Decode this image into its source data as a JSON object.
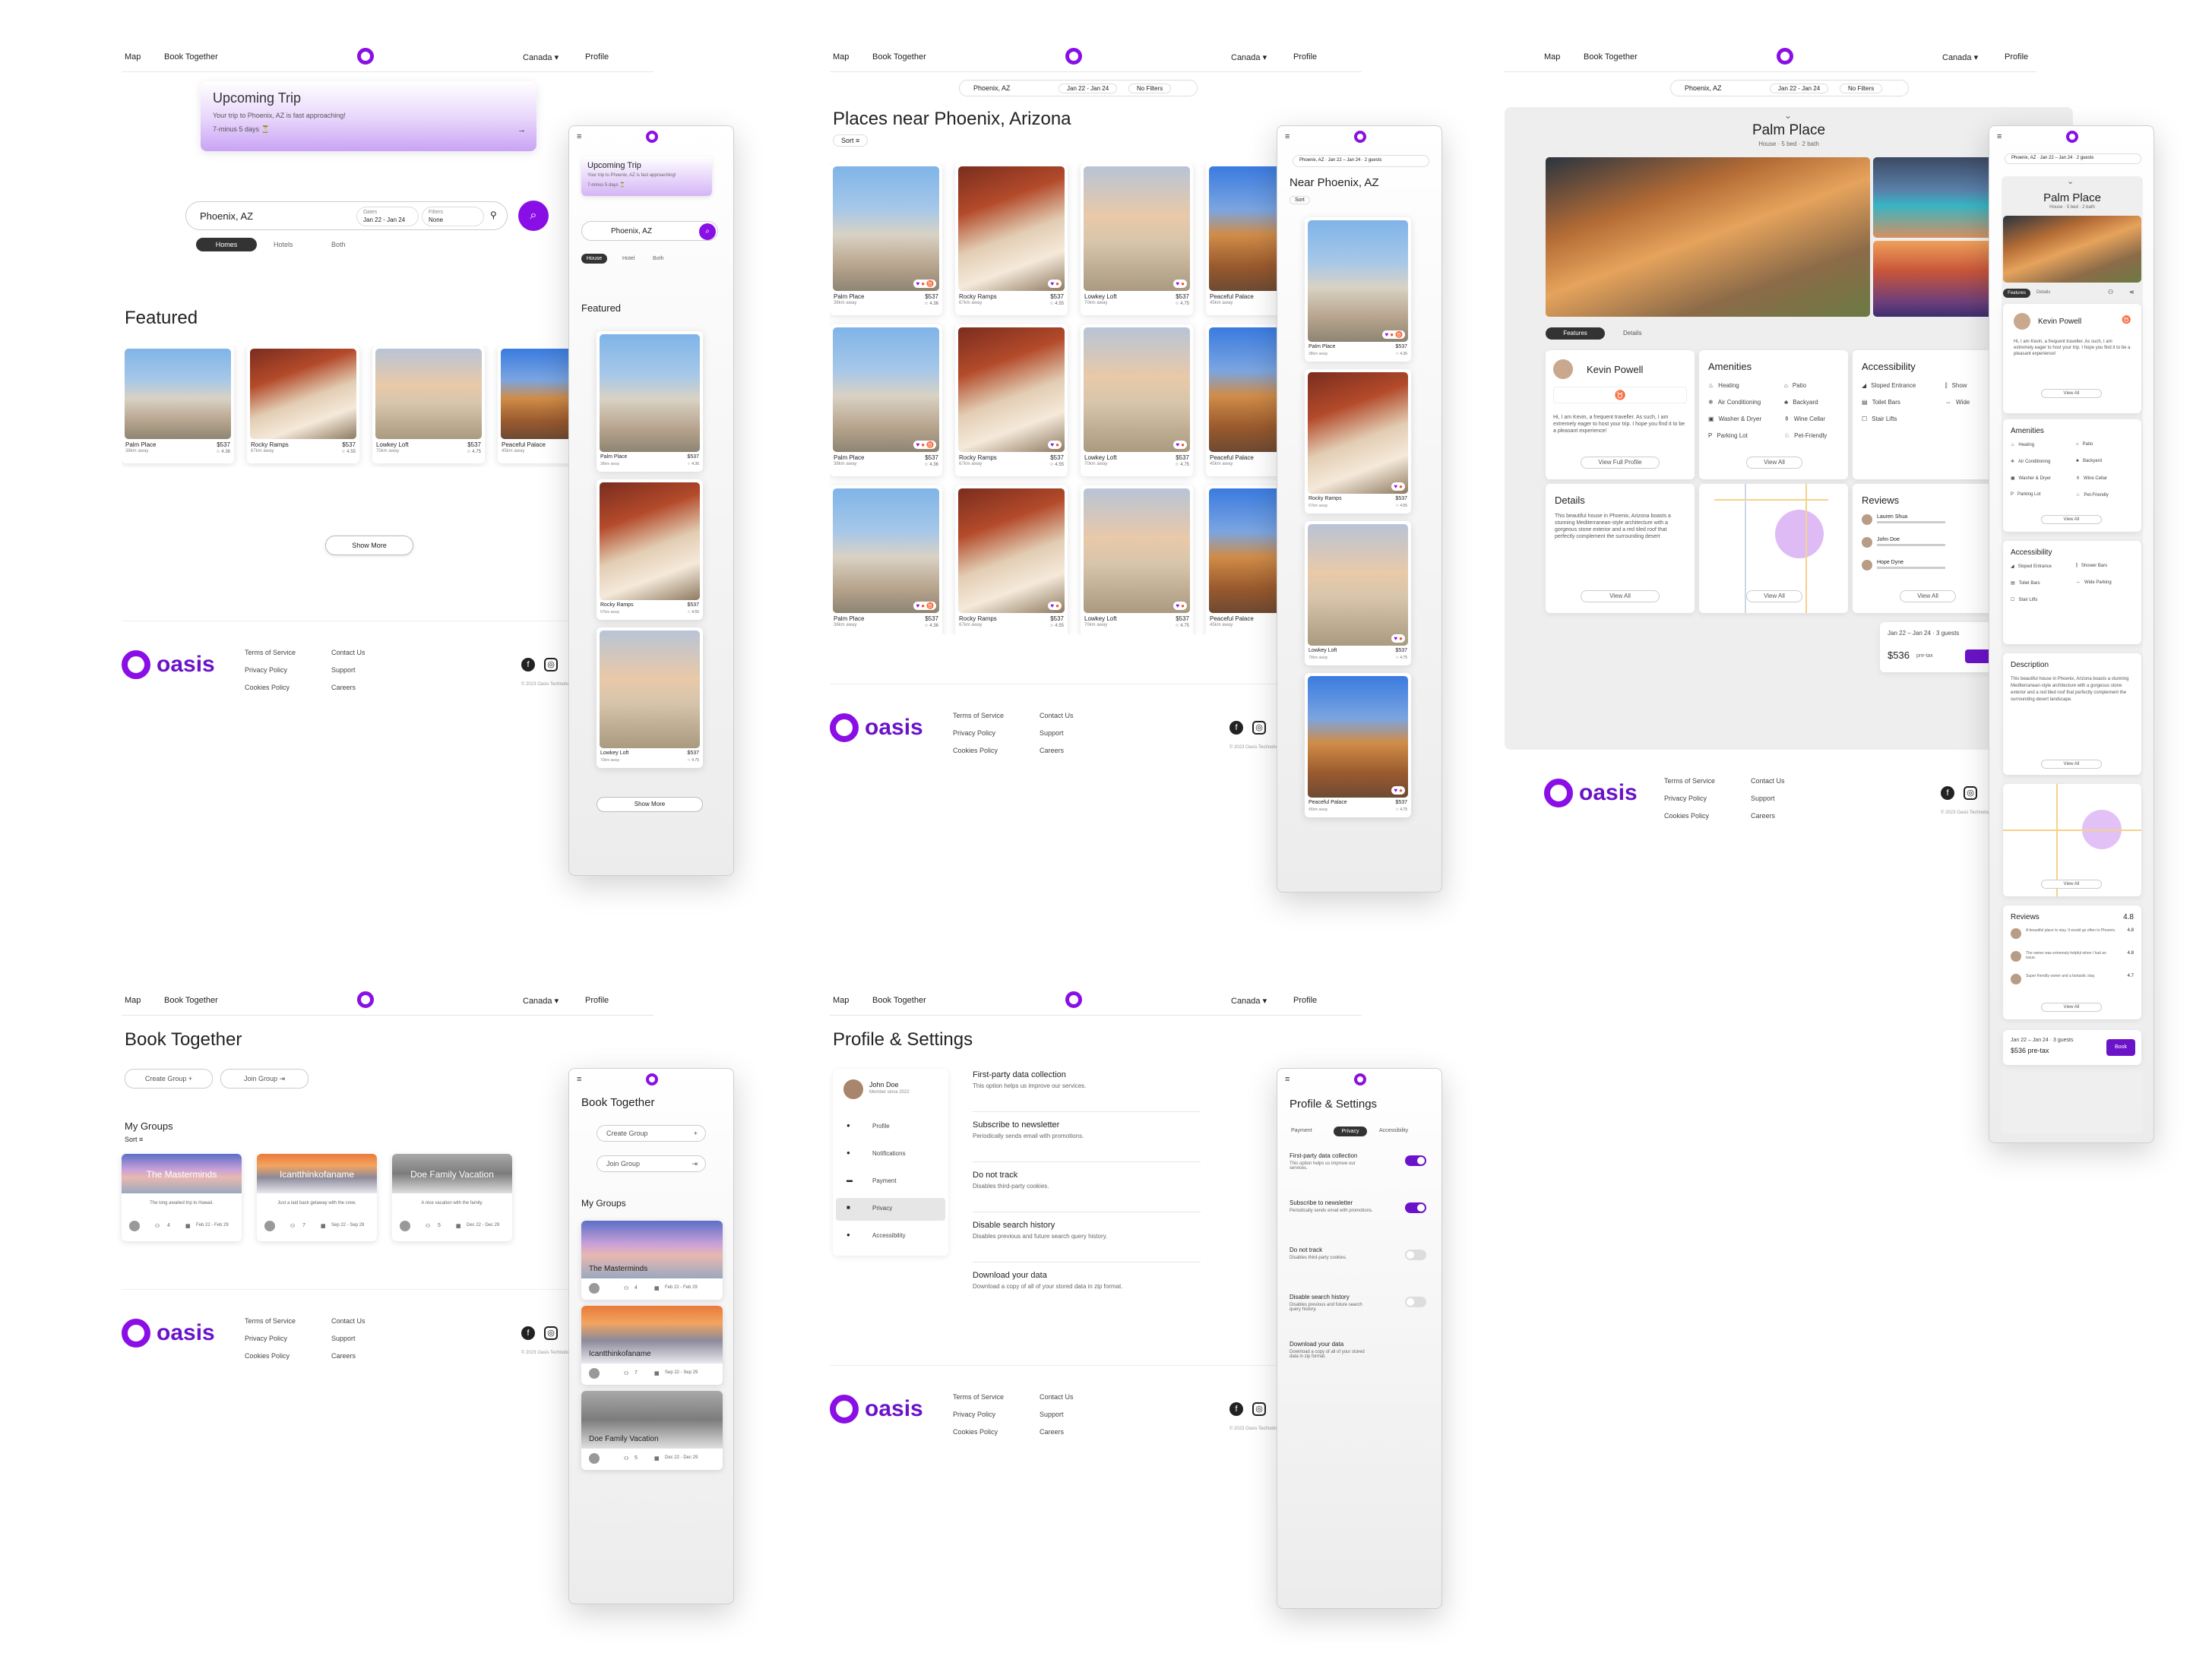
{
  "nav": {
    "map": "Map",
    "book_together": "Book Together",
    "country": "Canada ▾",
    "profile": "Profile"
  },
  "home": {
    "upcoming_title": "Upcoming Trip",
    "upcoming_text": "Your trip to Phoenix, AZ is fast approaching!",
    "upcoming_days": "7-minus 5 days ⏳",
    "search_value": "Phoenix, AZ",
    "dates_label": "Dates",
    "dates_value": "Jan 22 - Jan 24",
    "filters_label": "Filters",
    "filters_value": "None",
    "tabs": [
      "Homes",
      "Hotels",
      "Both"
    ],
    "featured": "Featured",
    "show_more": "Show More"
  },
  "listings": [
    {
      "name": "Palm Place",
      "price": "$537",
      "distance": "38km away",
      "rating": "4.36"
    },
    {
      "name": "Rocky Ramps",
      "price": "$537",
      "distance": "67km away",
      "rating": "4.55"
    },
    {
      "name": "Lowkey Loft",
      "price": "$537",
      "distance": "70km away",
      "rating": "4.75"
    },
    {
      "name": "Peaceful Palace",
      "price": "$537",
      "distance": "45km away",
      "rating": "4.75"
    }
  ],
  "mobile_home": {
    "upcoming_title": "Upcoming Trip",
    "upcoming_text": "Your trip to Phoenix, AZ is fast approaching!",
    "upcoming_days": "7-minus 5 days ⏳",
    "search": "Phoenix, AZ",
    "tabs": [
      "House",
      "Hotel",
      "Both"
    ],
    "featured": "Featured",
    "ratings": [
      "4.37",
      "4.36",
      "4.75"
    ],
    "show_more": "Show More"
  },
  "search": {
    "location": "Phoenix, AZ",
    "dates": "Jan 22 - Jan 24",
    "filters": "No Filters",
    "title": "Places near Phoenix, Arizona",
    "sort": "Sort"
  },
  "mobile_search": {
    "crumb": "Phoenix, AZ · Jan 22 – Jan 24 · 2 guests",
    "title": "Near Phoenix, AZ",
    "sort": "Sort"
  },
  "detail": {
    "location": "Phoenix, AZ",
    "dates": "Jan 22 - Jan 24",
    "filters": "No Filters",
    "title": "Palm Place",
    "subtitle": "House · 5 bed · 2 bath",
    "tabs": [
      "Features",
      "Details"
    ],
    "host_name": "Kevin Powell",
    "host_bio": "Hi, I am Kevin, a frequent traveller. As such, I am extremely eager to host your trip. I hope you find it to be a pleasant experience!",
    "view_profile": "View Full Profile",
    "amenities_title": "Amenities",
    "amenities": [
      "Heating",
      "Patio",
      "Air Conditioning",
      "Backyard",
      "Washer & Dryer",
      "Wine Cellar",
      "Parking Lot",
      "Pet-Friendly"
    ],
    "accessibility_title": "Accessibility",
    "accessibility": [
      "Sloped Entrance",
      "Show",
      "Toilet Bars",
      "Wide",
      "Stair Lifts"
    ],
    "view_all": "View All",
    "details_title": "Details",
    "details_text": "This beautiful house in Phoenix, Arizona boasts a stunning Mediterranean-style architecture with a gorgeous stone exterior and a red tiled roof that perfectly complement the surrounding desert",
    "reviews_title": "Reviews",
    "reviewers": [
      "Lauren Shua",
      "John Doe",
      "Hope Dyne"
    ],
    "booking_dates": "Jan 22 – Jan 24 · 3 guests",
    "booking_price": "$536",
    "price_note": "pre-tax"
  },
  "mobile_detail": {
    "crumb": "Phoenix, AZ · Jan 22 – Jan 24 · 2 guests",
    "title": "Palm Place",
    "subtitle": "House · 5 bed · 2 bath",
    "tabs": [
      "Features",
      "Details"
    ],
    "host": "Kevin Powell",
    "bio": "Hi, I am Kevin, a frequent traveller. As such, I am extremely eager to host your trip. I hope you find it to be a pleasant experience!",
    "amenities_title": "Amenities",
    "amenities": [
      "Heating",
      "Patio",
      "Air Conditioning",
      "Backyard",
      "Washer & Dryer",
      "Wine Cellar",
      "Parking Lot",
      "Pet-Friendly"
    ],
    "accessibility_title": "Accessibility",
    "accessibility": [
      "Sloped Entrance",
      "Shower Bars",
      "Toilet Bars",
      "Wide Parking",
      "Stair Lifts"
    ],
    "description_title": "Description",
    "description": "This beautiful house in Phoenix, Arizona boasts a stunning Mediterranean-style architecture with a gorgeous stone exterior and a red tiled roof that perfectly complement the surrounding desert landscape.",
    "reviews_title": "Reviews",
    "reviews_score": "4.8",
    "review_scores": [
      "4.8",
      "4.8",
      "4.7"
    ],
    "review_texts": [
      "A beautiful place to stay. It would go often to Phoenix.",
      "The owner was extremely helpful when I had an issue.",
      "Super friendly owner and a fantastic stay."
    ],
    "view_all": "View All",
    "booking_dates": "Jan 22 – Jan 24 · 3 guests",
    "booking_price": "$536 pre-tax",
    "book": "Book"
  },
  "book_together": {
    "title": "Book Together",
    "create": "Create Group",
    "join": "Join Group",
    "my_groups": "My Groups",
    "sort": "Sort",
    "groups": [
      {
        "name": "The Masterminds",
        "desc": "The long awaited trip to Hawaii.",
        "members": "4",
        "dates": "Feb 22 - Feb 29"
      },
      {
        "name": "Icantthinkofaname",
        "desc": "Just a laid back getaway with the crew.",
        "members": "7",
        "dates": "Sep 22 - Sep 29"
      },
      {
        "name": "Doe Family Vacation",
        "desc": "A nice vacation with the family.",
        "members": "5",
        "dates": "Dec 22 - Dec 29"
      }
    ]
  },
  "profile": {
    "title": "Profile & Settings",
    "user_name": "John Doe",
    "user_since": "Member since 2022",
    "menu": [
      "Profile",
      "Notifications",
      "Payment",
      "Privacy",
      "Accessibility"
    ],
    "settings": [
      {
        "title": "First-party data collection",
        "desc": "This option helps us improve our services."
      },
      {
        "title": "Subscribe to newsletter",
        "desc": "Periodically sends email with promotions."
      },
      {
        "title": "Do not track",
        "desc": "Disables third-party cookies."
      },
      {
        "title": "Disable search history",
        "desc": "Disables previous and future search query history."
      },
      {
        "title": "Download your data",
        "desc": "Download a copy of all of your stored data in zip format."
      }
    ],
    "mobile_tabs": [
      "Payment",
      "Privacy",
      "Accessibility"
    ],
    "toggles": [
      true,
      true,
      false,
      false
    ]
  },
  "footer": {
    "brand": "oasis",
    "terms": "Terms of Service",
    "privacy": "Privacy Policy",
    "cookies": "Cookies Policy",
    "contact": "Contact Us",
    "support": "Support",
    "careers": "Careers",
    "copyright": "© 2023 Oasis Technologies"
  },
  "colors": {
    "accent": "#8a0fe6",
    "brand": "#6a13c9"
  }
}
